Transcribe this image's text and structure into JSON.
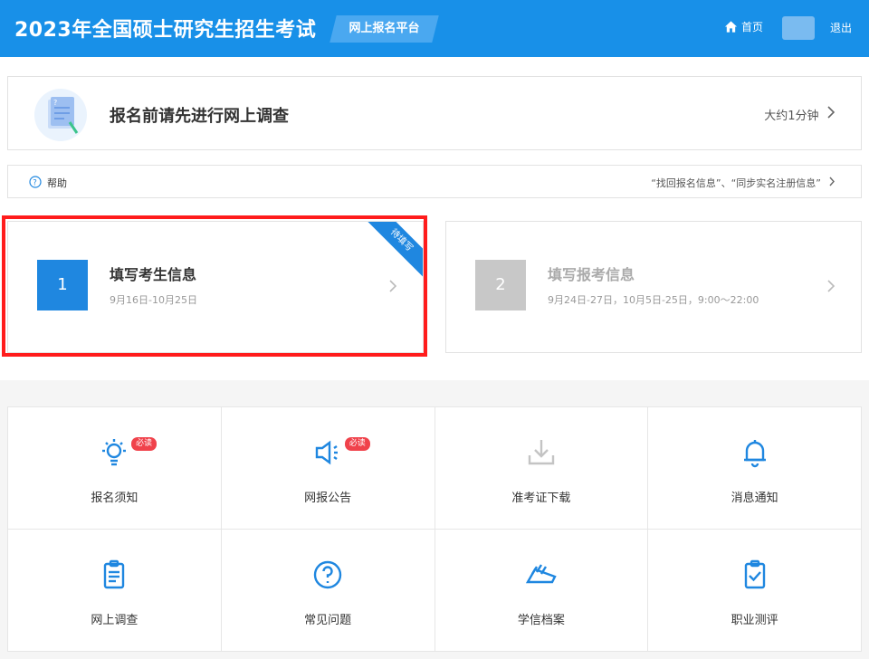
{
  "header": {
    "title": "2023年全国硕士研究生招生考试",
    "platform": "网上报名平台",
    "home_label": "首页",
    "logout_label": "退出"
  },
  "survey": {
    "title": "报名前请先进行网上调查",
    "time": "大约1分钟"
  },
  "help": {
    "label": "帮助",
    "links": "“找回报名信息”、“同步实名注册信息”"
  },
  "steps": [
    {
      "number": "1",
      "title": "填写考生信息",
      "dates": "9月16日-10月25日",
      "ribbon": "待填写"
    },
    {
      "number": "2",
      "title": "填写报考信息",
      "dates": "9月24日-27日，10月5日-25日，9:00～22:00"
    }
  ],
  "tiles": [
    {
      "label": "报名须知",
      "icon": "lightbulb-icon",
      "tag": "必读"
    },
    {
      "label": "网报公告",
      "icon": "megaphone-icon",
      "tag": "必读"
    },
    {
      "label": "准考证下载",
      "icon": "download-icon"
    },
    {
      "label": "消息通知",
      "icon": "bell-icon"
    },
    {
      "label": "网上调查",
      "icon": "clipboard-icon"
    },
    {
      "label": "常见问题",
      "icon": "question-circle-icon"
    },
    {
      "label": "学信档案",
      "icon": "books-icon"
    },
    {
      "label": "职业测评",
      "icon": "clipboard-check-icon"
    }
  ],
  "colors": {
    "primary": "#1890e8",
    "accent": "#1f87e0",
    "highlight": "#ff1c1c",
    "tag": "#f0424b",
    "disabled": "#c8c8c8"
  }
}
